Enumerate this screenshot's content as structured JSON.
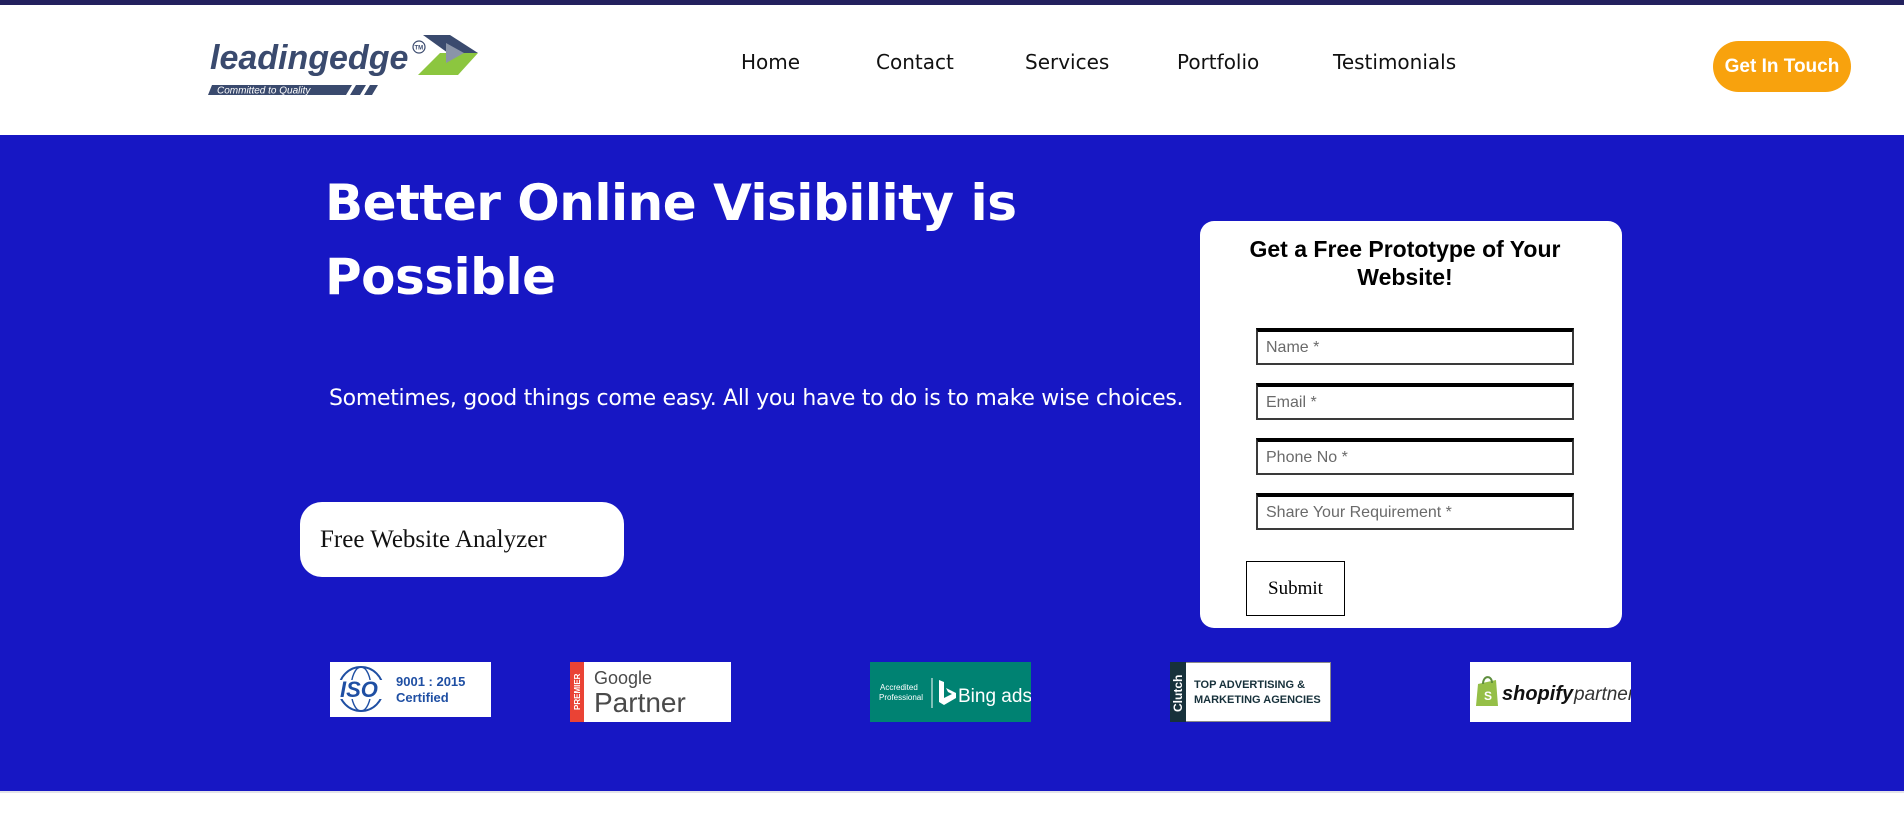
{
  "brand": {
    "name": "leadingedge",
    "trademark": "TM",
    "tagline": "Committed to Quality",
    "colors": {
      "navy": "#23215e",
      "slate": "#3a4a6e",
      "green": "#8cc63f",
      "orange": "#f8a20d"
    }
  },
  "nav": {
    "items": [
      {
        "label": "Home"
      },
      {
        "label": "Contact"
      },
      {
        "label": "Services"
      },
      {
        "label": "Portfolio"
      },
      {
        "label": "Testimonials"
      }
    ],
    "cta_label": "Get In Touch"
  },
  "hero": {
    "background": "#1717c4",
    "headline": "Better Online Visibility is Possible",
    "tagline": "Sometimes, good things come easy. All you have to do is to make wise choices.",
    "analyzer_label": "Free Website Analyzer"
  },
  "form": {
    "title": "Get a Free Prototype of Your Website!",
    "fields": [
      {
        "placeholder": "Name *"
      },
      {
        "placeholder": "Email *"
      },
      {
        "placeholder": "Phone No *"
      },
      {
        "placeholder": "Share Your Requirement *"
      }
    ],
    "submit_label": "Submit"
  },
  "badges": {
    "iso": {
      "mark": "ISO",
      "line1": "9001 : 2015",
      "line2": "Certified"
    },
    "google": {
      "ribbon": "PREMIER",
      "line1": "Google",
      "line2": "Partner"
    },
    "bing": {
      "line1": "Accredited",
      "line2": "Professional",
      "brand": "Bing ads"
    },
    "clutch": {
      "side": "Clutch",
      "line1": "TOP ADVERTISING &",
      "line2": "MARKETING AGENCIES"
    },
    "shopify": {
      "brand": "shopify",
      "suffix": "partner"
    }
  }
}
